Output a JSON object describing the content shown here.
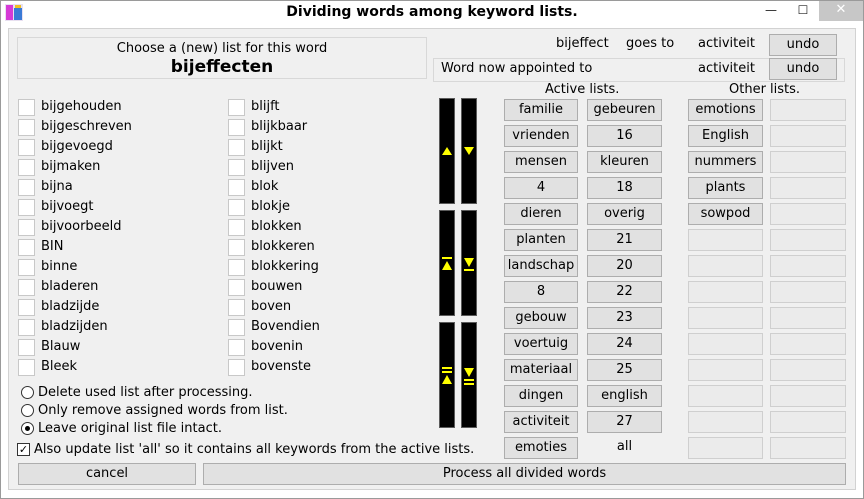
{
  "window": {
    "title": "Dividing words among keyword lists.",
    "minimize_glyph": "—",
    "maximize_glyph": "☐",
    "close_glyph": "✕",
    "icon": "app-logo-icon"
  },
  "choose": {
    "label": "Choose a (new) list for this word",
    "word": "bijeffecten"
  },
  "info": {
    "word": "bijeffect",
    "goes_to": "goes to",
    "target": "activiteit",
    "undo1": "undo",
    "appointed_label": "Word now appointed to",
    "appointed_target": "activiteit",
    "undo2": "undo"
  },
  "words_col1": [
    "bijgehouden",
    "bijgeschreven",
    "bijgevoegd",
    "bijmaken",
    "bijna",
    "bijvoegt",
    "bijvoorbeeld",
    "BIN",
    "binne",
    "bladeren",
    "bladzijde",
    "bladzijden",
    "Blauw",
    "Bleek"
  ],
  "words_col2": [
    "blijft",
    "blijkbaar",
    "blijkt",
    "blijven",
    "blok",
    "blokje",
    "blokken",
    "blokkeren",
    "blokkering",
    "bouwen",
    "boven",
    "Bovendien",
    "bovenin",
    "bovenste"
  ],
  "options": {
    "radio1": "Delete used list after processing.",
    "radio2": "Only remove assigned words from list.",
    "radio3": "Leave original list file intact.",
    "also_update": "Also update list 'all' so it contains all keywords from the active lists.",
    "check_mark": "✓"
  },
  "active": {
    "header": "Active lists.",
    "col1": [
      "familie",
      "vrienden",
      "mensen",
      "4",
      "dieren",
      "planten",
      "landschap",
      "8",
      "gebouw",
      "voertuig",
      "materiaal",
      "dingen",
      "activiteit",
      "emoties"
    ],
    "col2": [
      "gebeuren",
      "16",
      "kleuren",
      "18",
      "overig",
      "21",
      "20",
      "22",
      "23",
      "24",
      "25",
      "english",
      "27"
    ],
    "col2_last": "all"
  },
  "other": {
    "header": "Other lists.",
    "items": [
      "emotions",
      "English",
      "nummers",
      "plants",
      "sowpod"
    ]
  },
  "footer": {
    "cancel": "cancel",
    "process": "Process all divided words"
  }
}
